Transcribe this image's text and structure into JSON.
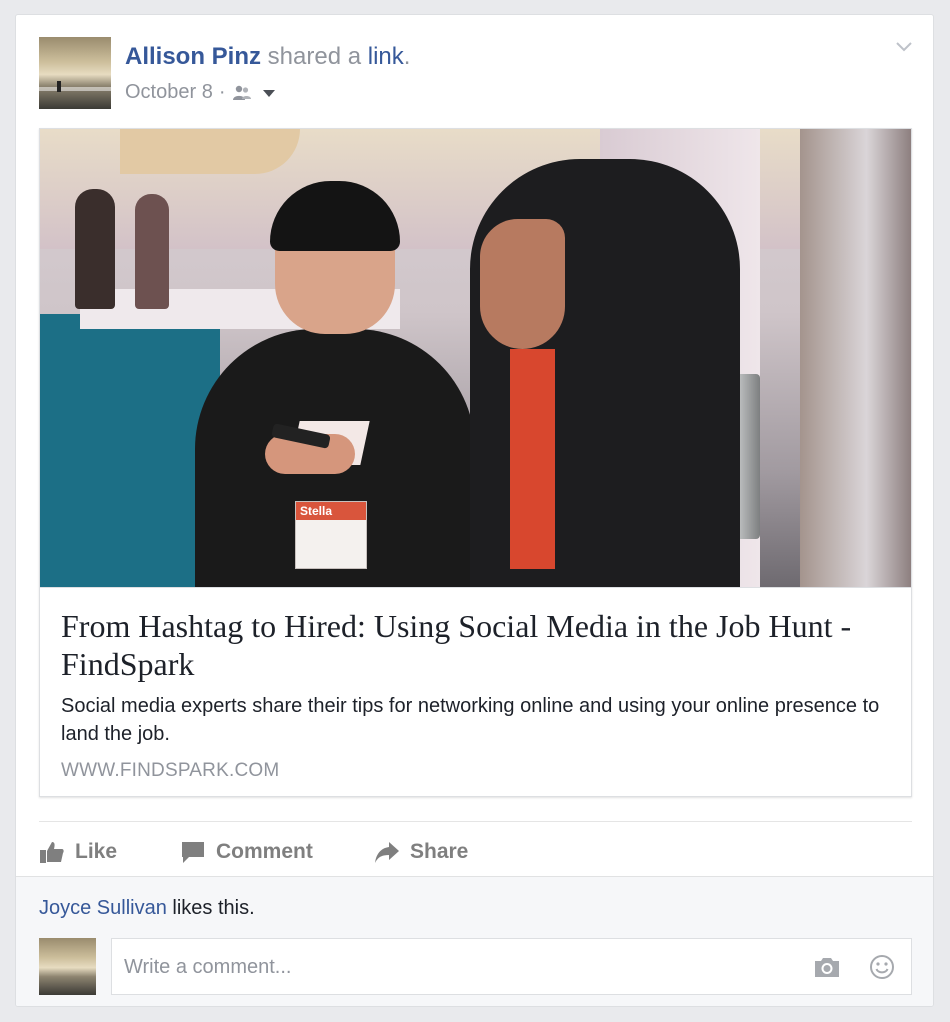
{
  "post": {
    "author": "Allison Pinz",
    "action": " shared a ",
    "object": "link",
    "period": ".",
    "date": "October 8",
    "separator": "·",
    "audience_icon": "friends-icon",
    "menu_icon": "chevron-down-icon"
  },
  "link_preview": {
    "title": "From Hashtag to Hired: Using Social Media in the Job Hunt - FindSpark",
    "description": "Social media experts share their tips for networking online and using your online presence to land the job.",
    "domain": "WWW.FINDSPARK.COM",
    "badge_text": "Stella"
  },
  "actions": {
    "like_label": "Like",
    "comment_label": "Comment",
    "share_label": "Share"
  },
  "likes": {
    "liker": "Joyce Sullivan",
    "suffix": " likes this."
  },
  "comment": {
    "placeholder": "Write a comment..."
  },
  "colors": {
    "link_blue": "#365899",
    "meta_gray": "#90949c",
    "action_gray": "#7f7f7f",
    "footer_bg": "#f6f7f9"
  }
}
